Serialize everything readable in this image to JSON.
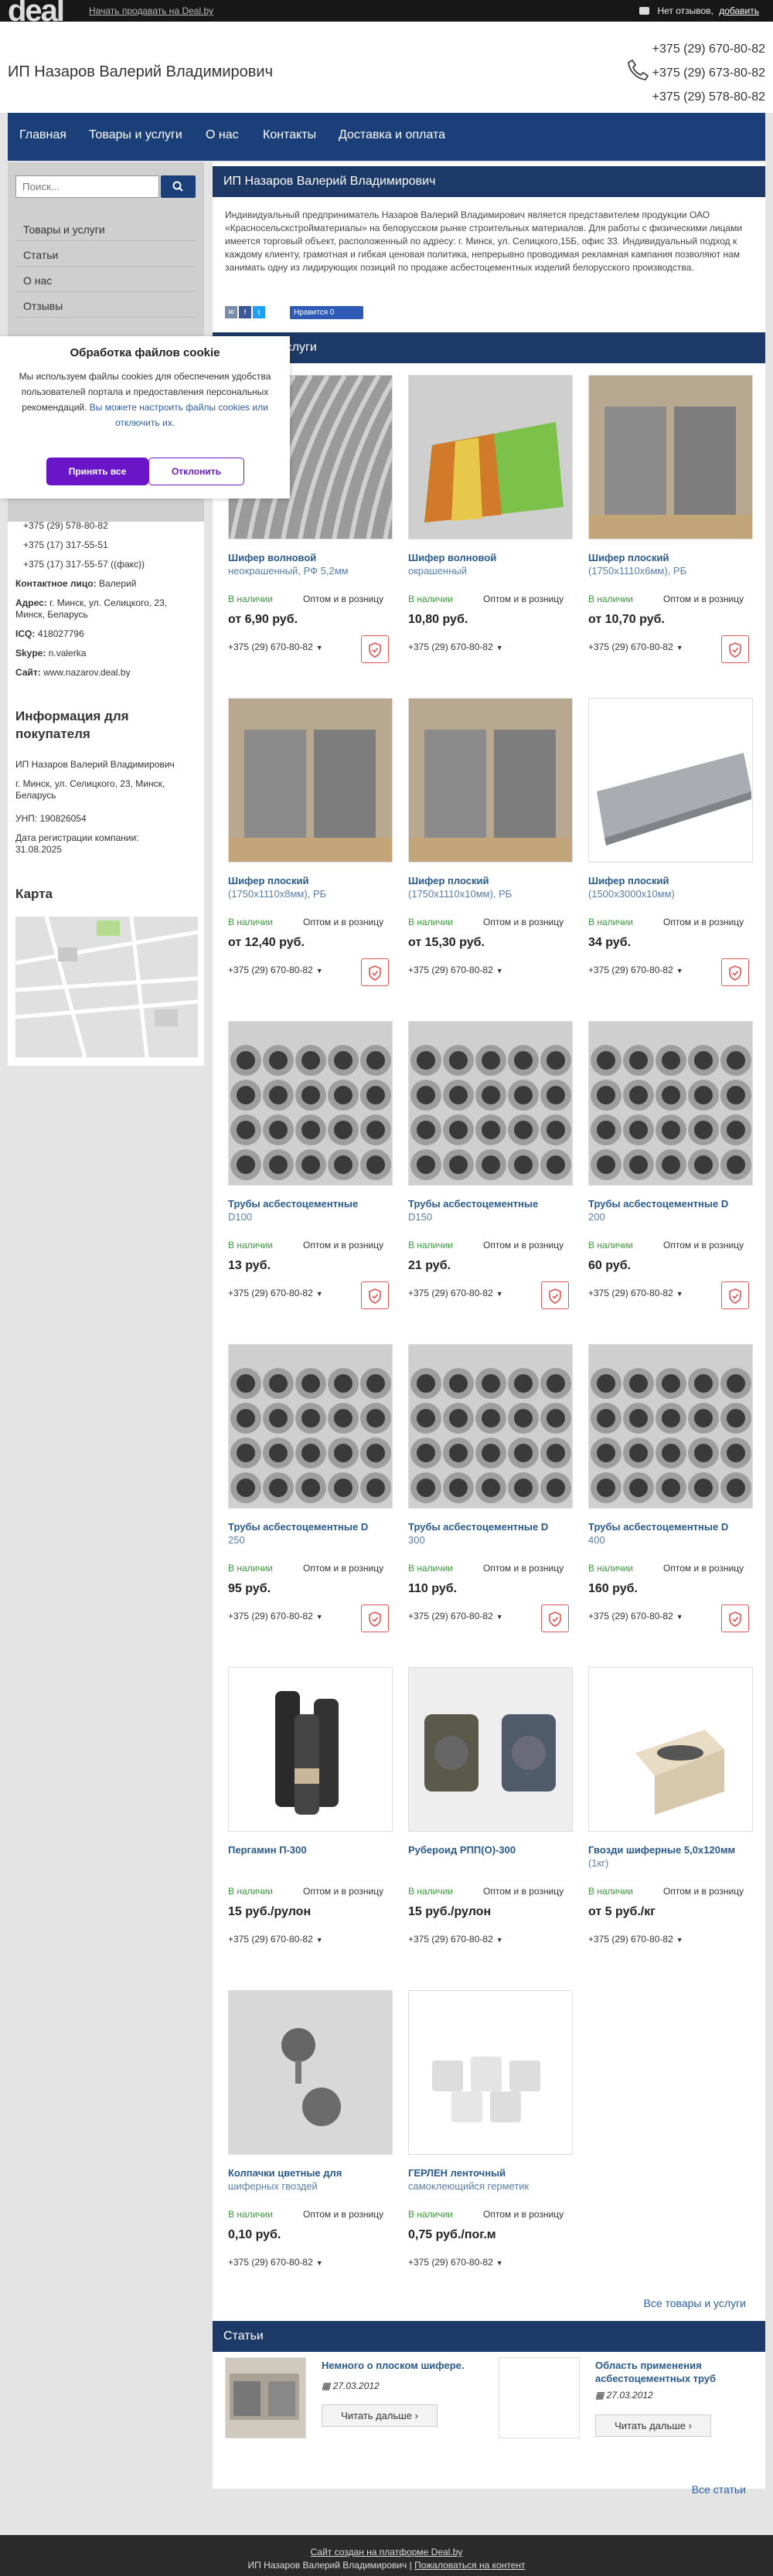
{
  "topbar": {
    "logo": "deal",
    "sell_link": "Начать продавать на Deal.by",
    "reviews": "Нет отзывов,",
    "add_review": "добавить"
  },
  "header": {
    "shop_name": "ИП Назаров Валерий Владимирович",
    "phones": [
      "+375 (29) 670-80-82",
      "+375 (29) 673-80-82",
      "+375 (29) 578-80-82"
    ]
  },
  "nav": [
    "Главная",
    "Товары и услуги",
    "О нас",
    "Контакты",
    "Доставка и оплата"
  ],
  "sidebar": {
    "search_placeholder": "Поиск...",
    "items": [
      "Товары и услуги",
      "Статьи",
      "О нас",
      "Отзывы"
    ],
    "contacts": {
      "phone1": "+375 (29) 578-80-82",
      "phone2": "+375 (17) 317-55-51",
      "phone3": "+375 (17) 317-55-57 ((факс))",
      "contact_label": "Контактное лицо:",
      "contact_value": "Валерий",
      "address_label": "Адрес:",
      "address_value": "г. Минск, ул. Селицкого, 23,",
      "address_line2": "Минск, Беларусь",
      "icq_label": "ICQ:",
      "icq_value": "418027796",
      "skype_label": "Skype:",
      "skype_value": "n.valerka",
      "site_label": "Сайт:",
      "site_value": "www.nazarov.deal.by"
    },
    "buyer_title": "Информация для покупателя",
    "buyer_name": "ИП Назаров Валерий Владимирович",
    "buyer_addr1": "г. Минск, ул. Селицкого, 23, Минск,",
    "buyer_addr2": "Беларусь",
    "unp": "УНП: 190826054",
    "reg_label": "Дата регистрации компании:",
    "reg_date": "31.08.2025",
    "map_title": "Карта"
  },
  "cookie": {
    "title": "Обработка файлов cookie",
    "text": "Мы используем файлы cookies для обеспечения удобства пользователей портала и предоставления персональных рекомендаций.",
    "link": "Вы можете настроить файлы cookies или отключить их.",
    "accept": "Принять все",
    "reject": "Отклонить"
  },
  "main": {
    "title": "ИП Назаров Валерий Владимирович",
    "about": "Индивидуальный предприниматель Назаров Валерий Владимирович является представителем продукции ОАО «Красносельскстройматериалы» на белорусском рынке строительных материалов. Для работы с физическими лицами имеется торговый объект, расположенный по адресу: г. Минск, ул. Селицкого,15Б, офис 33. Индивидуальный подход к каждому клиенту, грамотная и гибкая ценовая политика, непрерывно проводимая рекламная кампания позволяют нам занимать одну из лидирующих позиций по продаже асбестоцементных изделий белорусского производства.",
    "like": "Нравится 0",
    "products_title": "Товары и услуги"
  },
  "product_common": {
    "stock": "В наличии",
    "opt": "Оптом и в розницу",
    "phone": "+375 (29) 670-80-82"
  },
  "products": [
    {
      "name": "Шифер волновой",
      "sub": "неокрашенный, РФ 5,2мм",
      "price": "от 6,90 руб."
    },
    {
      "name": "Шифер волновой",
      "sub": "окрашенный",
      "price": "10,80 руб."
    },
    {
      "name": "Шифер плоский",
      "sub": "(1750х1110х6мм), РБ",
      "price": "от 10,70 руб."
    },
    {
      "name": "Шифер плоский",
      "sub": "(1750х1110х8мм), РБ",
      "price": "от 12,40 руб."
    },
    {
      "name": "Шифер плоский",
      "sub": "(1750х1110х10мм), РБ",
      "price": "от 15,30 руб."
    },
    {
      "name": "Шифер плоский",
      "sub": "(1500х3000х10мм)",
      "price": "34 руб."
    },
    {
      "name": "Трубы асбестоцементные",
      "sub": "D100",
      "price": "13 руб."
    },
    {
      "name": "Трубы асбестоцементные",
      "sub": "D150",
      "price": "21 руб."
    },
    {
      "name": "Трубы асбестоцементные D",
      "sub": "200",
      "price": "60 руб."
    },
    {
      "name": "Трубы асбестоцементные D",
      "sub": "250",
      "price": "95 руб."
    },
    {
      "name": "Трубы асбестоцементные D",
      "sub": "300",
      "price": "110 руб."
    },
    {
      "name": "Трубы асбестоцементные D",
      "sub": "400",
      "price": "160 руб."
    },
    {
      "name": "Пергамин П-300",
      "sub": "",
      "price": "15 руб./рулон"
    },
    {
      "name": "Рубероид РПП(О)-300",
      "sub": "",
      "price": "15 руб./рулон"
    },
    {
      "name": "Гвозди шиферные 5,0х120мм",
      "sub": "(1кг)",
      "price": "от 5 руб./кг"
    },
    {
      "name": "Колпачки цветные для",
      "sub": "шиферных гвоздей",
      "price": "0,10 руб."
    },
    {
      "name": "ГЕРЛЕН ленточный",
      "sub": "самоклеющийся герметик",
      "price": "0,75 руб./пог.м"
    }
  ],
  "all_goods": "Все товары и услуги",
  "articles_title": "Статьи",
  "articles": [
    {
      "title": "Немного о плоском шифере.",
      "date": "27.03.2012",
      "more": "Читать дальше"
    },
    {
      "title": "Область применения асбестоцементных труб",
      "date": "27.03.2012",
      "more": "Читать дальше"
    }
  ],
  "all_articles": "Все статьи",
  "footer": {
    "line1": "Сайт создан на платформе Deal.by",
    "owner": "ИП Назаров Валерий Владимирович",
    "sep": " | ",
    "complain": "Пожаловаться на контент"
  },
  "colors": {
    "nav": "#1b3f78",
    "accent": "#6a16c8",
    "stock": "#3a9a3a",
    "link": "#2a5fa8"
  }
}
